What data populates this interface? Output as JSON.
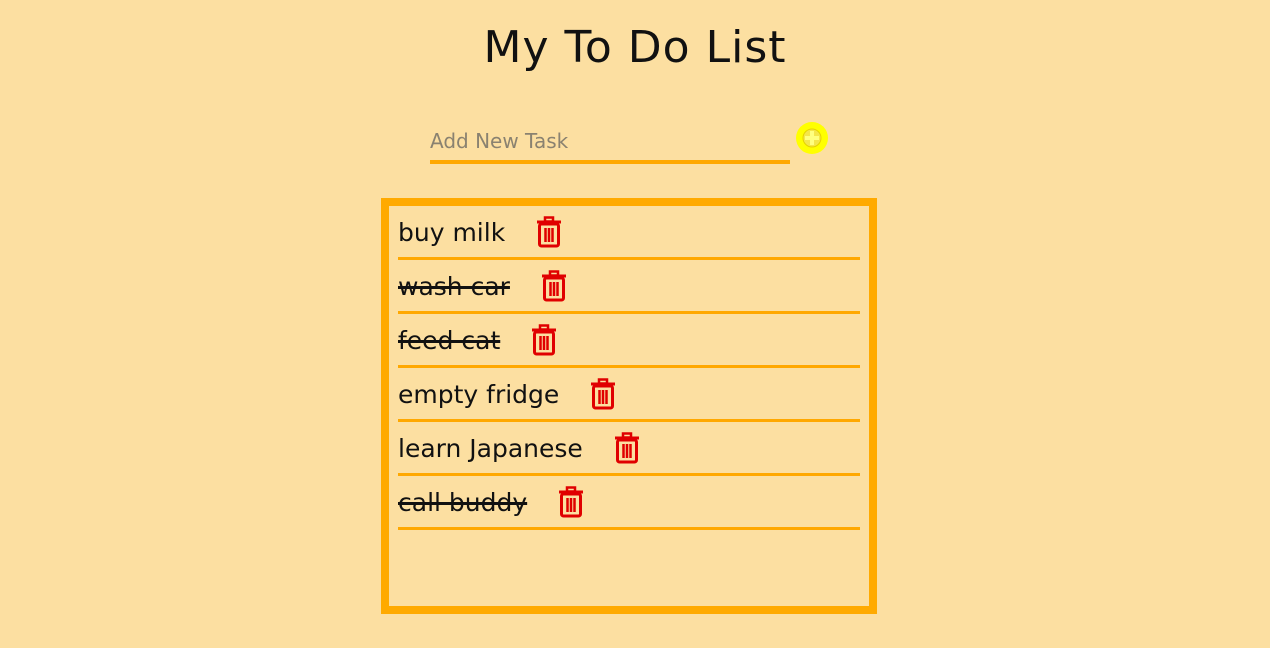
{
  "app": {
    "title": "My To Do List"
  },
  "new_task": {
    "placeholder": "Add New Task",
    "value": "",
    "add_icon": "plus-circle-icon"
  },
  "tasks": [
    {
      "label": "buy milk",
      "done": false
    },
    {
      "label": "wash car",
      "done": true
    },
    {
      "label": "feed cat",
      "done": true
    },
    {
      "label": "empty fridge",
      "done": false
    },
    {
      "label": "learn Japanese",
      "done": false
    },
    {
      "label": "call buddy",
      "done": true
    }
  ],
  "icons": {
    "delete": "trash-icon"
  },
  "colors": {
    "background": "#FCDFA1",
    "accent": "#FFA800",
    "add_button": "#FFFF00",
    "delete": "#E00000"
  }
}
